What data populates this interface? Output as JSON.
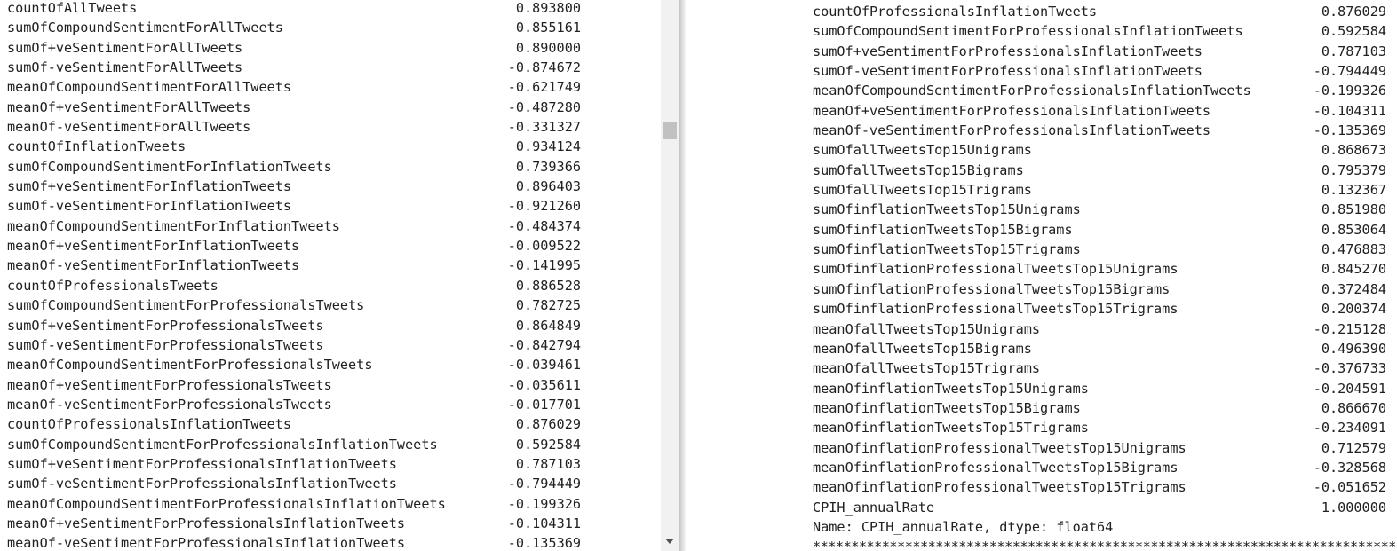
{
  "left_output": {
    "rows": [
      {
        "label": "countOfAllTweets",
        "value": "0.893800"
      },
      {
        "label": "sumOfCompoundSentimentForAllTweets",
        "value": "0.855161"
      },
      {
        "label": "sumOf+veSentimentForAllTweets",
        "value": "0.890000"
      },
      {
        "label": "sumOf-veSentimentForAllTweets",
        "value": "-0.874672"
      },
      {
        "label": "meanOfCompoundSentimentForAllTweets",
        "value": "-0.621749"
      },
      {
        "label": "meanOf+veSentimentForAllTweets",
        "value": "-0.487280"
      },
      {
        "label": "meanOf-veSentimentForAllTweets",
        "value": "-0.331327"
      },
      {
        "label": "countOfInflationTweets",
        "value": "0.934124"
      },
      {
        "label": "sumOfCompoundSentimentForInflationTweets",
        "value": "0.739366"
      },
      {
        "label": "sumOf+veSentimentForInflationTweets",
        "value": "0.896403"
      },
      {
        "label": "sumOf-veSentimentForInflationTweets",
        "value": "-0.921260"
      },
      {
        "label": "meanOfCompoundSentimentForInflationTweets",
        "value": "-0.484374"
      },
      {
        "label": "meanOf+veSentimentForInflationTweets",
        "value": "-0.009522"
      },
      {
        "label": "meanOf-veSentimentForInflationTweets",
        "value": "-0.141995"
      },
      {
        "label": "countOfProfessionalsTweets",
        "value": "0.886528"
      },
      {
        "label": "sumOfCompoundSentimentForProfessionalsTweets",
        "value": "0.782725"
      },
      {
        "label": "sumOf+veSentimentForProfessionalsTweets",
        "value": "0.864849"
      },
      {
        "label": "sumOf-veSentimentForProfessionalsTweets",
        "value": "-0.842794"
      },
      {
        "label": "meanOfCompoundSentimentForProfessionalsTweets",
        "value": "-0.039461"
      },
      {
        "label": "meanOf+veSentimentForProfessionalsTweets",
        "value": "-0.035611"
      },
      {
        "label": "meanOf-veSentimentForProfessionalsTweets",
        "value": "-0.017701"
      },
      {
        "label": "countOfProfessionalsInflationTweets",
        "value": "0.876029"
      },
      {
        "label": "sumOfCompoundSentimentForProfessionalsInflationTweets",
        "value": "0.592584"
      },
      {
        "label": "sumOf+veSentimentForProfessionalsInflationTweets",
        "value": "0.787103"
      },
      {
        "label": "sumOf-veSentimentForProfessionalsInflationTweets",
        "value": "-0.794449"
      },
      {
        "label": "meanOfCompoundSentimentForProfessionalsInflationTweets",
        "value": "-0.199326"
      },
      {
        "label": "meanOf+veSentimentForProfessionalsInflationTweets",
        "value": "-0.104311"
      },
      {
        "label": "meanOf-veSentimentForProfessionalsInflationTweets",
        "value": "-0.135369"
      }
    ]
  },
  "right_output": {
    "rows": [
      {
        "label": "countOfProfessionalsInflationTweets",
        "value": "0.876029"
      },
      {
        "label": "sumOfCompoundSentimentForProfessionalsInflationTweets",
        "value": "0.592584"
      },
      {
        "label": "sumOf+veSentimentForProfessionalsInflationTweets",
        "value": "0.787103"
      },
      {
        "label": "sumOf-veSentimentForProfessionalsInflationTweets",
        "value": "-0.794449"
      },
      {
        "label": "meanOfCompoundSentimentForProfessionalsInflationTweets",
        "value": "-0.199326"
      },
      {
        "label": "meanOf+veSentimentForProfessionalsInflationTweets",
        "value": "-0.104311"
      },
      {
        "label": "meanOf-veSentimentForProfessionalsInflationTweets",
        "value": "-0.135369"
      },
      {
        "label": "sumOfallTweetsTop15Unigrams",
        "value": "0.868673"
      },
      {
        "label": "sumOfallTweetsTop15Bigrams",
        "value": "0.795379"
      },
      {
        "label": "sumOfallTweetsTop15Trigrams",
        "value": "0.132367"
      },
      {
        "label": "sumOfinflationTweetsTop15Unigrams",
        "value": "0.851980"
      },
      {
        "label": "sumOfinflationTweetsTop15Bigrams",
        "value": "0.853064"
      },
      {
        "label": "sumOfinflationTweetsTop15Trigrams",
        "value": "0.476883"
      },
      {
        "label": "sumOfinflationProfessionalTweetsTop15Unigrams",
        "value": "0.845270"
      },
      {
        "label": "sumOfinflationProfessionalTweetsTop15Bigrams",
        "value": "0.372484"
      },
      {
        "label": "sumOfinflationProfessionalTweetsTop15Trigrams",
        "value": "0.200374"
      },
      {
        "label": "meanOfallTweetsTop15Unigrams",
        "value": "-0.215128"
      },
      {
        "label": "meanOfallTweetsTop15Bigrams",
        "value": "0.496390"
      },
      {
        "label": "meanOfallTweetsTop15Trigrams",
        "value": "-0.376733"
      },
      {
        "label": "meanOfinflationTweetsTop15Unigrams",
        "value": "-0.204591"
      },
      {
        "label": "meanOfinflationTweetsTop15Bigrams",
        "value": "0.866670"
      },
      {
        "label": "meanOfinflationTweetsTop15Trigrams",
        "value": "-0.234091"
      },
      {
        "label": "meanOfinflationProfessionalTweetsTop15Unigrams",
        "value": "0.712579"
      },
      {
        "label": "meanOfinflationProfessionalTweetsTop15Bigrams",
        "value": "-0.328568"
      },
      {
        "label": "meanOfinflationProfessionalTweetsTop15Trigrams",
        "value": "-0.051652"
      },
      {
        "label": "CPIH_annualRate",
        "value": "1.000000"
      }
    ],
    "name_line": "Name: CPIH_annualRate, dtype: float64",
    "separator": "**********************************************************************************************************"
  },
  "colors": {
    "text": "#212121",
    "scrollbar_track": "#f1f1f1",
    "scrollbar_thumb": "#c1c1c1",
    "background": "#ffffff"
  },
  "icons": {
    "scroll_down": "chevron-down-icon"
  }
}
